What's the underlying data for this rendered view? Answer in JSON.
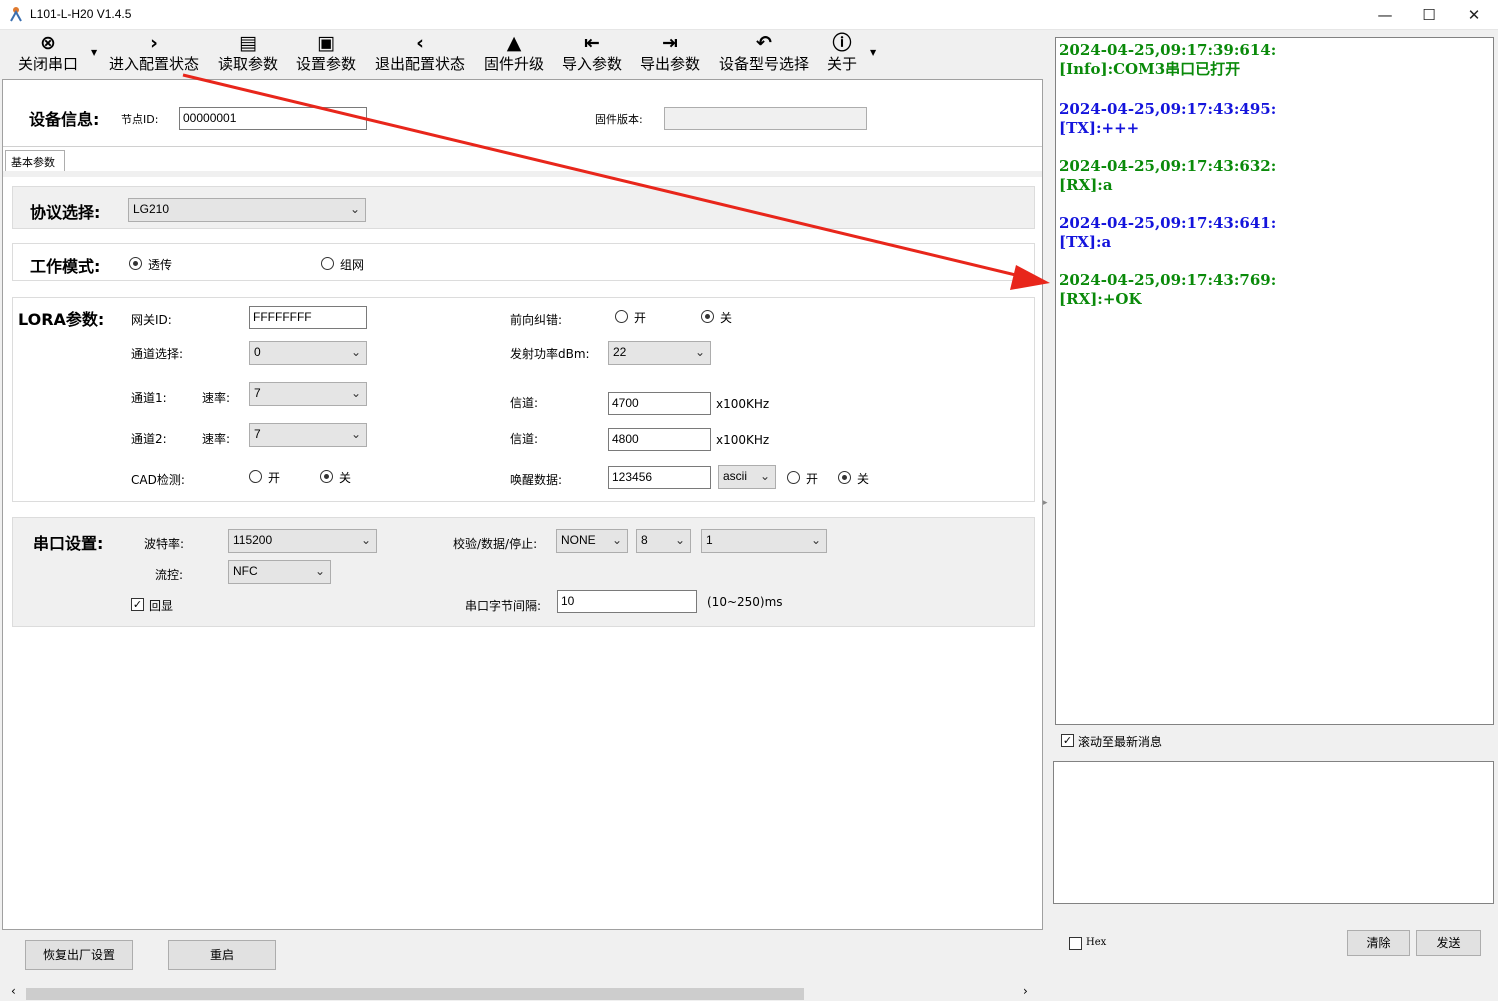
{
  "window": {
    "title": "L101-L-H20 V1.4.5",
    "min": "—",
    "max": "☐",
    "close": "✕"
  },
  "toolbar": [
    {
      "icon": "close-port-icon",
      "glyph": "⊗",
      "label": "关闭串口"
    },
    {
      "icon": "chevron-right-icon",
      "glyph": "›",
      "label": "进入配置状态"
    },
    {
      "icon": "read-params-icon",
      "glyph": "▤",
      "label": "读取参数"
    },
    {
      "icon": "save-icon",
      "glyph": "▣",
      "label": "设置参数"
    },
    {
      "icon": "chevron-left-icon",
      "glyph": "‹",
      "label": "退出配置状态"
    },
    {
      "icon": "rocket-icon",
      "glyph": "▲",
      "label": "固件升级"
    },
    {
      "icon": "import-icon",
      "glyph": "⇤",
      "label": "导入参数"
    },
    {
      "icon": "export-icon",
      "glyph": "⇥",
      "label": "导出参数"
    },
    {
      "icon": "undo-icon",
      "glyph": "↶",
      "label": "设备型号选择"
    },
    {
      "icon": "info-icon",
      "glyph": "ⓘ",
      "label": "关于"
    }
  ],
  "device_info": {
    "header": "设备信息:",
    "node_id_label": "节点ID:",
    "node_id_value": "00000001",
    "firmware_label": "固件版本:",
    "firmware_value": ""
  },
  "tab": {
    "label": "基本参数"
  },
  "protocol": {
    "header": "协议选择:",
    "value": "LG210"
  },
  "work_mode": {
    "header": "工作模式:",
    "opt1": "透传",
    "opt2": "组网",
    "selected": "透传"
  },
  "lora": {
    "header": "LORA参数:",
    "gateway_id_label": "网关ID:",
    "gateway_id_value": "FFFFFFFF",
    "fec_label": "前向纠错:",
    "fec_on": "开",
    "fec_off": "关",
    "fec_selected": "关",
    "channel_select_label": "通道选择:",
    "channel_select_value": "0",
    "tx_power_label": "发射功率dBm:",
    "tx_power_value": "22",
    "ch1_label": "通道1:",
    "ch1_rate_label": "速率:",
    "ch1_rate_value": "7",
    "ch1_freq_label": "信道:",
    "ch1_freq_value": "4700",
    "ch1_unit": "x100KHz",
    "ch2_label": "通道2:",
    "ch2_rate_label": "速率:",
    "ch2_rate_value": "7",
    "ch2_freq_label": "信道:",
    "ch2_freq_value": "4800",
    "ch2_unit": "x100KHz",
    "cad_label": "CAD检测:",
    "cad_on": "开",
    "cad_off": "关",
    "cad_selected": "关",
    "wake_label": "唤醒数据:",
    "wake_value": "123456",
    "wake_format": "ascii",
    "wake_on": "开",
    "wake_off": "关",
    "wake_selected": "关"
  },
  "serial": {
    "header": "串口设置:",
    "baud_label": "波特率:",
    "baud_value": "115200",
    "parity_label": "校验/数据/停止:",
    "parity_value": "NONE",
    "data_bits": "8",
    "stop_bits": "1",
    "flow_label": "流控:",
    "flow_value": "NFC",
    "echo_label": "回显",
    "echo_checked": true,
    "interval_label": "串口字节间隔:",
    "interval_value": "10",
    "interval_range": "(10~250)ms"
  },
  "log": [
    {
      "time": "2024-04-25,09:17:39:614:",
      "msg": "[Info]:COM3串口已打开",
      "color": "#0a8a0a"
    },
    {
      "time": "2024-04-25,09:17:43:495:",
      "msg": "[TX]:+++",
      "color": "#1414dc"
    },
    {
      "time": "2024-04-25,09:17:43:632:",
      "msg": "[RX]:a",
      "color": "#0a8a0a"
    },
    {
      "time": "2024-04-25,09:17:43:641:",
      "msg": "[TX]:a",
      "color": "#1414dc"
    },
    {
      "time": "2024-04-25,09:17:43:769:",
      "msg": "[RX]:+OK",
      "color": "#0a8a0a"
    }
  ],
  "right": {
    "autoscroll_label": "滚动至最新消息",
    "autoscroll_checked": true,
    "send_text": "",
    "hex_label": "Hex",
    "hex_checked": false,
    "clear_label": "清除",
    "send_label": "发送"
  },
  "bottom": {
    "factory_reset": "恢复出厂设置",
    "restart": "重启"
  },
  "colors": {
    "annotation_arrow": "#e8261b",
    "tx": "#1414dc",
    "rx": "#0a8a0a"
  }
}
